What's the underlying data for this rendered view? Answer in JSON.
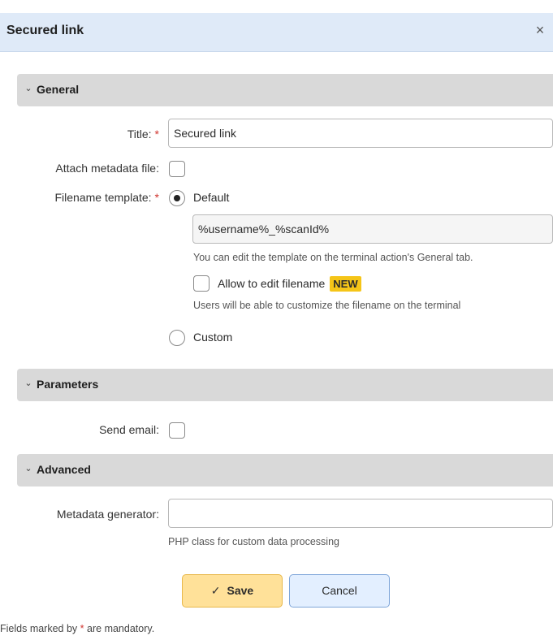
{
  "dialog": {
    "title": "Secured link",
    "close_icon": "close-icon",
    "close_glyph": "×"
  },
  "sections": {
    "general": {
      "label": "General",
      "chevron": "⌄"
    },
    "parameters": {
      "label": "Parameters",
      "chevron": "⌄"
    },
    "advanced": {
      "label": "Advanced",
      "chevron": "⌄"
    }
  },
  "general": {
    "title_label": "Title:",
    "title_value": "Secured link",
    "attach_label": "Attach metadata file:",
    "attach_checked": false,
    "filename_label": "Filename template:",
    "default_label": "Default",
    "default_selected": true,
    "template_value": "%username%_%scanId%",
    "template_hint": "You can edit the template on the terminal action's General tab.",
    "allow_edit_label": "Allow to edit filename",
    "allow_edit_checked": false,
    "new_badge": "NEW",
    "allow_edit_hint": "Users will be able to customize the filename on the terminal",
    "custom_label": "Custom",
    "custom_selected": false
  },
  "parameters": {
    "send_email_label": "Send email:",
    "send_email_checked": false
  },
  "advanced": {
    "metadata_label": "Metadata generator:",
    "metadata_value": "",
    "metadata_hint": "PHP class for custom data processing"
  },
  "buttons": {
    "save_label": "Save",
    "save_icon": "✓",
    "cancel_label": "Cancel"
  },
  "required_marker": "*",
  "footer": {
    "prefix": "Fields marked by",
    "marker": "*",
    "suffix": "are mandatory."
  },
  "colors": {
    "titlebar_bg": "#dfeaf8",
    "section_bg": "#d9d9d9",
    "required": "#d0352f",
    "save_bg": "#ffe199",
    "cancel_bg": "#e3efff",
    "badge_bg": "#f5c518"
  }
}
